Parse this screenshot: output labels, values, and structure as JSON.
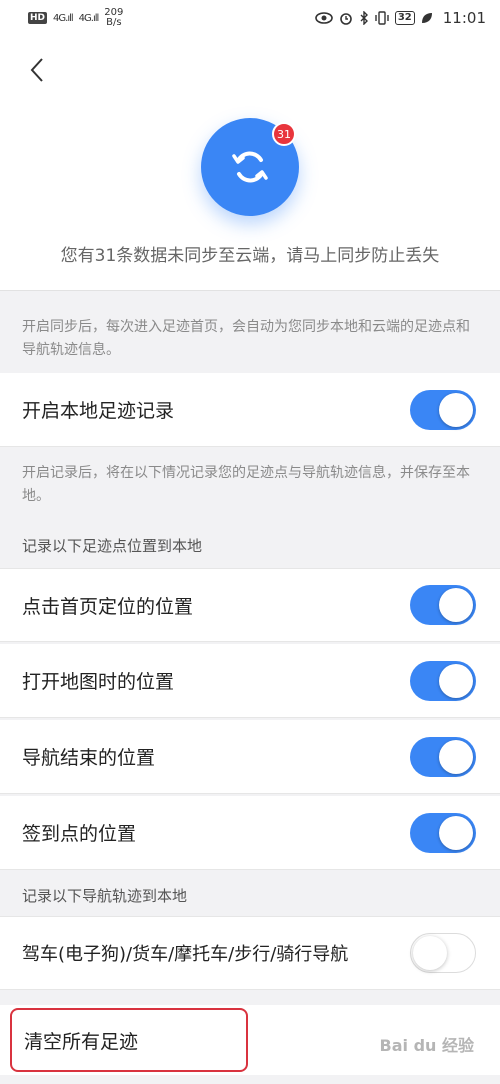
{
  "status_bar": {
    "hd": "HD",
    "signal1": "4G",
    "signal2": "4G",
    "speed_value": "209",
    "speed_unit": "B/s",
    "battery": "32",
    "time": "11:01"
  },
  "sync": {
    "badge_count": "31",
    "message": "您有31条数据未同步至云端，请马上同步防止丢失"
  },
  "sync_note": "开启同步后，每次进入足迹首页，会自动为您同步本地和云端的足迹点和导航轨迹信息。",
  "local_record": {
    "label": "开启本地足迹记录",
    "on": true
  },
  "record_note": "开启记录后，将在以下情况记录您的足迹点与导航轨迹信息，并保存至本地。",
  "points_section_title": "记录以下足迹点位置到本地",
  "point_items": [
    {
      "label": "点击首页定位的位置",
      "on": true
    },
    {
      "label": "打开地图时的位置",
      "on": true
    },
    {
      "label": "导航结束的位置",
      "on": true
    },
    {
      "label": "签到点的位置",
      "on": true
    }
  ],
  "track_section_title": "记录以下导航轨迹到本地",
  "track_item": {
    "label": "驾车(电子狗)/货车/摩托车/步行/骑行导航",
    "on": false
  },
  "clear_all_label": "清空所有足迹",
  "watermark": "Bai du 经验",
  "colors": {
    "accent": "#3a86f5",
    "badge": "#e8353d",
    "highlight_border": "#d9333f"
  }
}
